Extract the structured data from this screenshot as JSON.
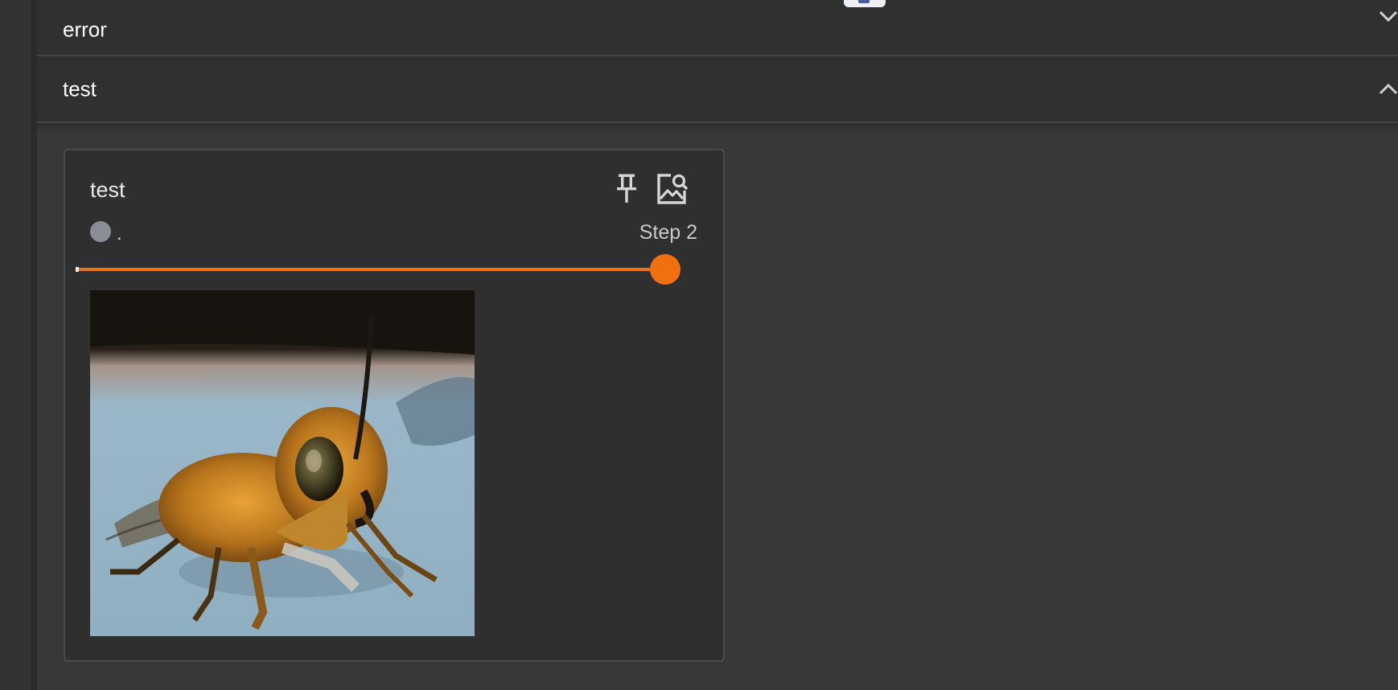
{
  "sections": [
    {
      "title": "error",
      "state": "collapsed"
    },
    {
      "title": "test",
      "state": "expanded"
    }
  ],
  "card": {
    "title": "test",
    "run_label": ".",
    "run_color": "#8a8e96",
    "step_label": "Step 2",
    "slider": {
      "position": 1.0
    },
    "icons": [
      "pin-icon",
      "image-search-icon"
    ]
  },
  "colors": {
    "accent": "#f07010",
    "background": "#383838",
    "card_background": "#2f2f2f"
  }
}
